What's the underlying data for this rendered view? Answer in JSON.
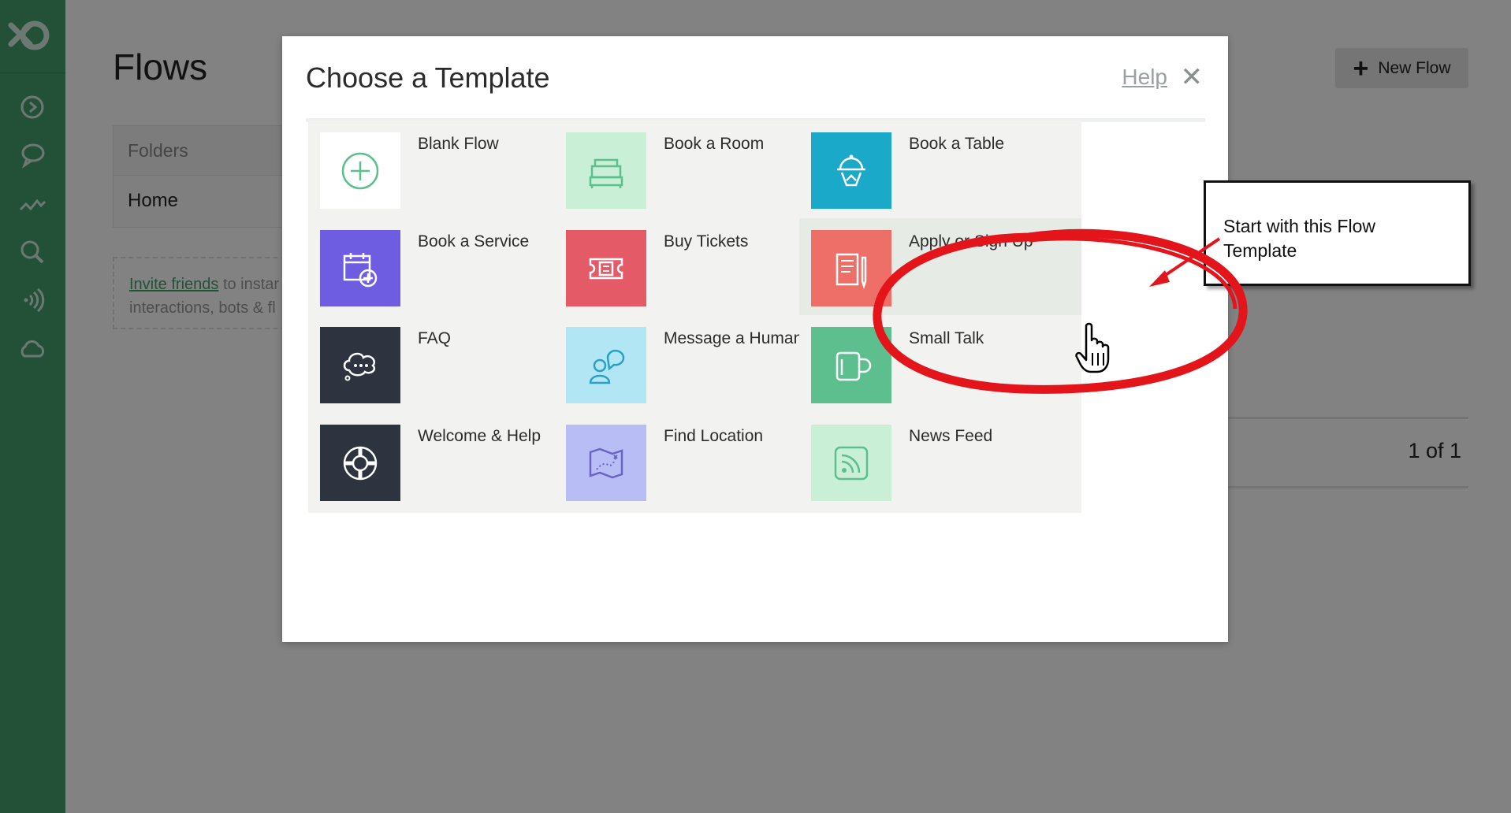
{
  "app": {
    "title": "Flows",
    "new_flow_label": "New Flow",
    "sidebar_icons": [
      "logo-icon",
      "play-circle-icon",
      "chat-bubble-icon",
      "activity-icon",
      "search-icon",
      "broadcast-icon",
      "cloud-icon"
    ]
  },
  "folders": {
    "header": "Folders",
    "home": "Home"
  },
  "invite": {
    "link": "Invite friends",
    "line1_rest": " to instar",
    "line2": "interactions, bots & fl"
  },
  "pager": {
    "text": "1 of 1"
  },
  "modal": {
    "title": "Choose a Template",
    "help_label": "Help",
    "close_label": "✕",
    "templates": [
      {
        "label": "Blank Flow",
        "icon": "plus-circle-icon",
        "tile_color": "#ffffff",
        "icon_color": "#5cbf8d"
      },
      {
        "label": "Book a Room",
        "icon": "bed-icon",
        "tile_color": "#c9f0d6",
        "icon_color": "#5cbf8d"
      },
      {
        "label": "Book a Table",
        "icon": "waiter-icon",
        "tile_color": "#1aa9c9",
        "icon_color": "#ffffff"
      },
      {
        "label": "Book a Service",
        "icon": "calendar-add-icon",
        "tile_color": "#6f5de1",
        "icon_color": "#ffffff"
      },
      {
        "label": "Buy Tickets",
        "icon": "ticket-icon",
        "tile_color": "#e45a66",
        "icon_color": "#ffffff"
      },
      {
        "label": "Apply or Sign Up",
        "icon": "form-pen-icon",
        "tile_color": "#ee6f68",
        "icon_color": "#ffffff"
      },
      {
        "label": "FAQ",
        "icon": "thought-bubble-icon",
        "tile_color": "#2d3440",
        "icon_color": "#ffffff"
      },
      {
        "label": "Message a Human",
        "icon": "person-chat-icon",
        "tile_color": "#b3e6f4",
        "icon_color": "#2aa0c4"
      },
      {
        "label": "Small Talk",
        "icon": "mug-icon",
        "tile_color": "#5cbf8d",
        "icon_color": "#ffffff"
      },
      {
        "label": "Welcome & Help",
        "icon": "lifebuoy-icon",
        "tile_color": "#2d3440",
        "icon_color": "#ffffff"
      },
      {
        "label": "Find Location",
        "icon": "map-icon",
        "tile_color": "#b9bdf5",
        "icon_color": "#6a64c8"
      },
      {
        "label": "News Feed",
        "icon": "rss-icon",
        "tile_color": "#c9f0d6",
        "icon_color": "#5cbf8d"
      }
    ]
  },
  "annotation": {
    "callout_line1": "Start with this Flow",
    "callout_line2": "Template",
    "highlight_color": "#e3151b"
  }
}
